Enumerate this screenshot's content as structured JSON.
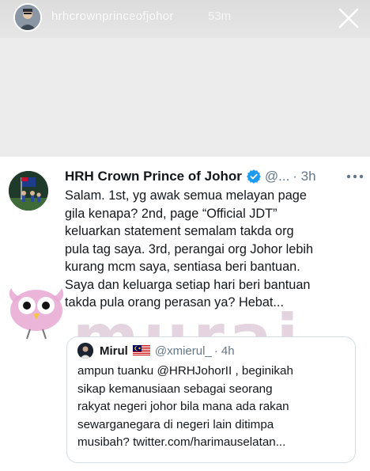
{
  "story": {
    "username": "hrhcrownprinceofjohor",
    "time": "53m"
  },
  "tweet": {
    "name": "HRH Crown Prince of Johor",
    "handle": "@...",
    "time": "· 3h",
    "body_lines": [
      "Salam. 1st, yg awak semua melayan page",
      "gila kenapa? 2nd, page “Official JDT”",
      "keluarkan statement semalam takda org",
      "pula tag saya. 3rd, perangai org Johor lebih",
      "kurang mcm saya, sentiasa beri bantuan.",
      "Saya dan keluarga setiap hari beri bantuan",
      "takda pula orang perasan ya? Hebat..."
    ]
  },
  "quote": {
    "name": "Mirul",
    "handle": "@xmierul_",
    "time": "· 4h",
    "body_lines": [
      "ampun tuanku @HRHJohorII , beginikah",
      "sikap kemanusiaan sebagai seorang",
      "rakyat negeri johor bila mana ada rakan",
      "sewarganegara di negeri lain ditimpa",
      "musibah? twitter.com/harimauselatan..."
    ]
  },
  "watermark": {
    "text": "murai"
  },
  "colors": {
    "verified": "#1d9bf0",
    "secondary_text": "#657786",
    "story_bg": "#ececec"
  },
  "icons": {
    "close": "close-icon",
    "verified": "verified-badge-icon",
    "more": "more-options-icon",
    "flag": "malaysia-flag-icon"
  }
}
